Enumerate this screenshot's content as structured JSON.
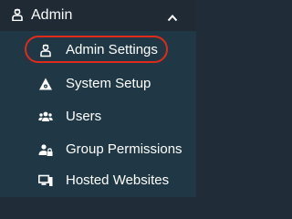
{
  "header": {
    "title": "Admin",
    "icon": "admin-person-icon",
    "toggle_icon": "chevron-up-icon"
  },
  "menu": {
    "items": [
      {
        "label": "Admin Settings",
        "icon": "admin-person-icon",
        "highlighted": true
      },
      {
        "label": "System Setup",
        "icon": "system-setup-icon"
      },
      {
        "label": "Users",
        "icon": "users-icon"
      },
      {
        "label": "Group Permissions",
        "icon": "group-lock-icon"
      },
      {
        "label": "Hosted Websites",
        "icon": "hosted-websites-icon"
      }
    ]
  },
  "colors": {
    "header_bg": "#1f2a35",
    "menu_bg": "#203846",
    "text": "#ffffff",
    "highlight_ring": "#e02a1c"
  }
}
